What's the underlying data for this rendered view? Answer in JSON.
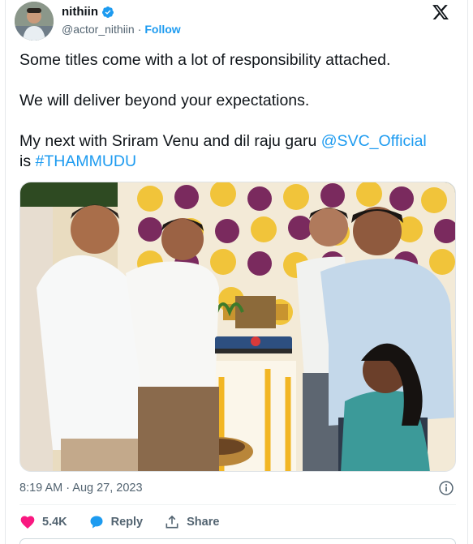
{
  "tweet": {
    "author_name": "nithiin",
    "handle": "@actor_nithiin",
    "separator": "·",
    "follow_label": "Follow",
    "text_line1": "Some titles come with a lot of responsibility attached.",
    "text_line2": "We will deliver beyond your expectations.",
    "text_line3_prefix": "My next with Sriram Venu and dil raju garu ",
    "mention": "@SVC_Official",
    "text_line4_prefix": "is ",
    "hashtag": "#THAMMUDU",
    "timestamp": "8:19 AM · Aug 27, 2023",
    "likes_count": "5.4K",
    "reply_label": "Reply",
    "share_label": "Share"
  },
  "icons": {
    "verified": "verified-badge-icon",
    "x_logo": "x-logo-icon",
    "info": "info-icon",
    "like": "heart-icon",
    "reply": "chat-bubble-icon",
    "share": "share-upload-icon"
  },
  "colors": {
    "accent": "#1d9bf0",
    "like": "#f91880",
    "text": "#0f1419",
    "muted": "#536471"
  }
}
